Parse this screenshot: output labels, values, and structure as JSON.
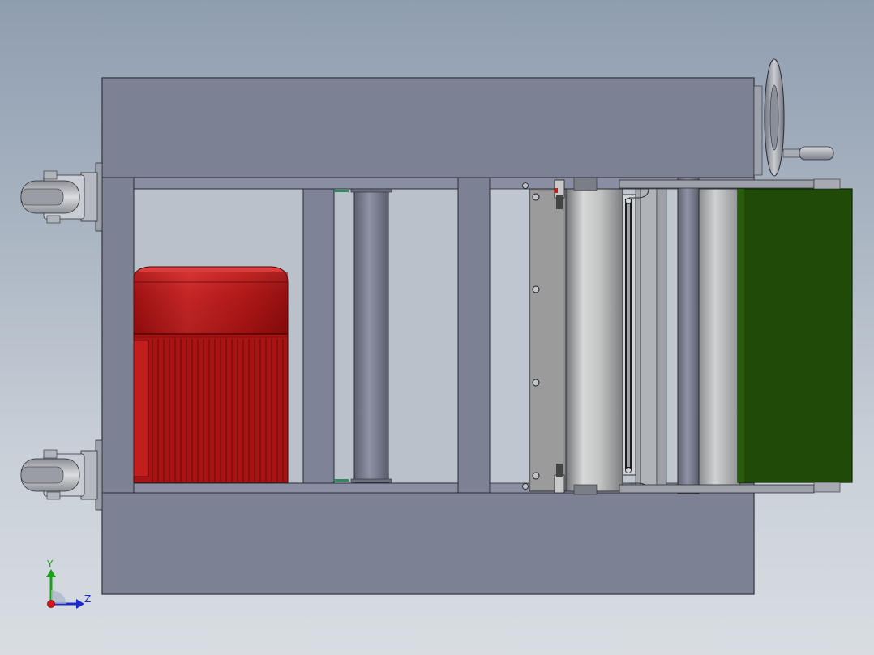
{
  "view": {
    "background_top": "#8f9db0",
    "background_bottom": "#d8dde2"
  },
  "model": {
    "frame_color": "#7d8194",
    "frame_edge": "#2a2c33",
    "motor_color": "#b01818",
    "belt_color": "#1f4a08",
    "roller_color": "#b4b6b6"
  },
  "triad": {
    "y_label": "Y",
    "z_label": "Z",
    "y_color": "#1aa01a",
    "z_color": "#1a2ad0",
    "x_color": "#d01a1a"
  }
}
